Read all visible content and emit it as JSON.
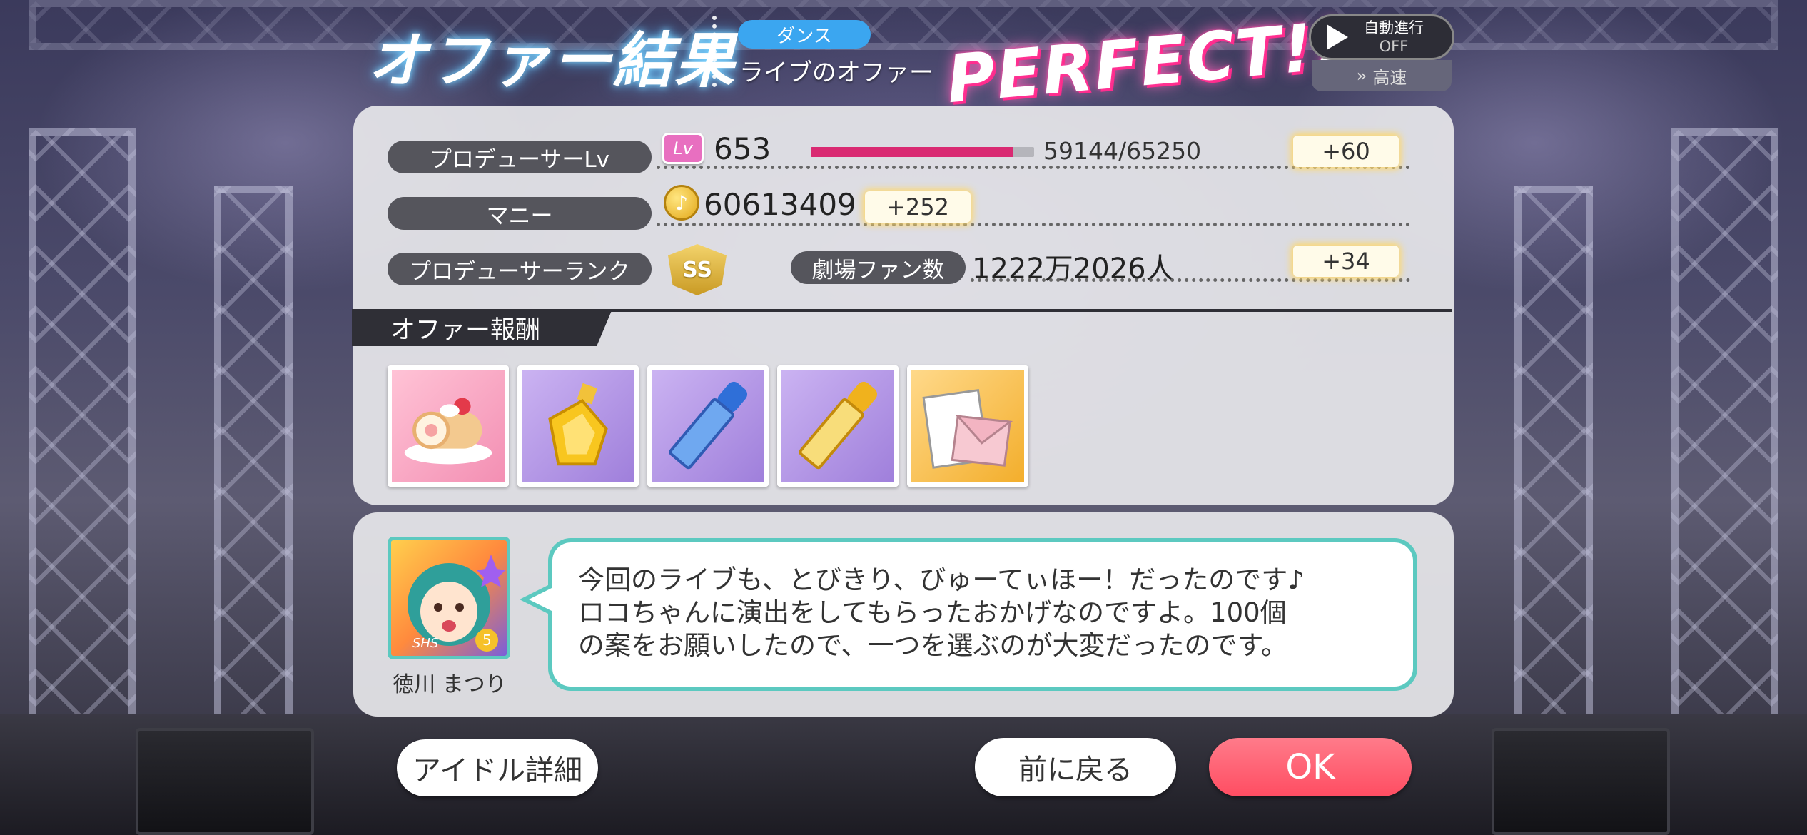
{
  "header": {
    "title": "オファー結果",
    "type_tag": "ダンス",
    "subtitle": "ライブのオファー",
    "result": "PERFECT!!",
    "auto_label": "自動進行",
    "auto_state": "OFF",
    "speed_label": "高速"
  },
  "stats": {
    "producer_lv_label": "プロデューサーLv",
    "lv_icon": "Lv",
    "producer_lv": "653",
    "exp": "59144/65250",
    "exp_progress": 0.906,
    "lv_gain": "+60",
    "money_label": "マニー",
    "money_value": "60613409",
    "money_gain": "+252",
    "rank_label": "プロデューサーランク",
    "rank_badge": "SS",
    "fans_label": "劇場ファン数",
    "fans_value": "1222万2026人",
    "fans_gain": "+34"
  },
  "rewards": {
    "header": "オファー報酬",
    "items": [
      {
        "icon": "roll-cake-icon",
        "bg": "#f6a9c2"
      },
      {
        "icon": "perfume-bottle-icon",
        "bg": "#b79be4"
      },
      {
        "icon": "blue-lipstick-icon",
        "bg": "#b79be4"
      },
      {
        "icon": "gold-lipstick-icon",
        "bg": "#b79be4"
      },
      {
        "icon": "letter-icon",
        "bg": "#f7c24e"
      }
    ]
  },
  "dialog": {
    "idol_name": "徳川 まつり",
    "rarity": "SHS",
    "stars": "5",
    "lines": [
      "今回のライブも、とびきり、びゅーてぃほー！だったのです♪",
      "ロコちゃんに演出をしてもらったおかげなのですよ。100個",
      "の案をお願いしたので、一つを選ぶのが大変だったのです。"
    ]
  },
  "buttons": {
    "idol_detail": "アイドル詳細",
    "back": "前に戻る",
    "ok": "OK"
  },
  "colors": {
    "accent_teal": "#5cc9c0",
    "ok_red": "#ff4d62",
    "lv_bar": "#d92a72"
  }
}
